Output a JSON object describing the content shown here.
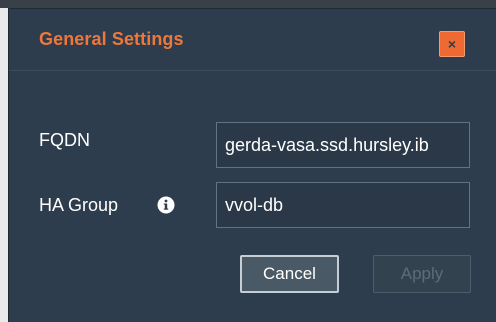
{
  "dialog": {
    "title": "General Settings",
    "close_label": "×"
  },
  "form": {
    "fqdn_label": "FQDN",
    "fqdn_value": "gerda-vasa.ssd.hursley.ib",
    "ha_group_label": "HA Group",
    "ha_group_value": "vvol-db"
  },
  "buttons": {
    "cancel": "Cancel",
    "apply": "Apply"
  },
  "icons": {
    "close": "close-icon",
    "info": "info-icon"
  },
  "colors": {
    "accent": "#f0773a",
    "dialog_bg": "#2e3d4d",
    "close_button": "#ef6a33"
  }
}
